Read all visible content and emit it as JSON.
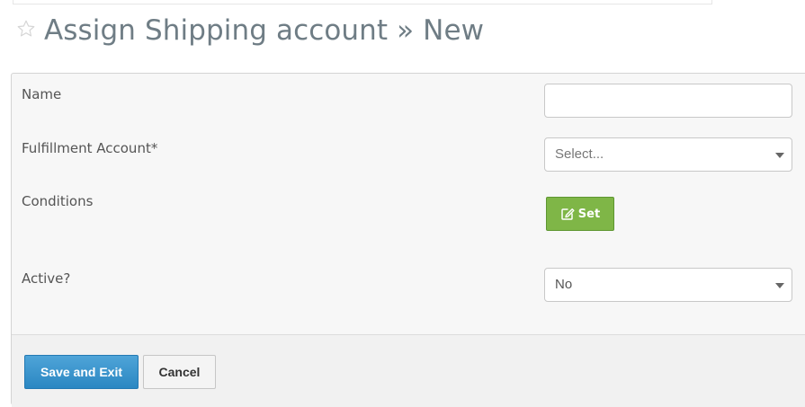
{
  "header": {
    "title": "Assign Shipping account » New",
    "favorite_icon": "star-outline-icon"
  },
  "form": {
    "name_label": "Name",
    "name_value": "",
    "fulfillment_label": "Fulfillment Account*",
    "fulfillment_value": "Select...",
    "conditions_label": "Conditions",
    "set_label": "Set",
    "set_icon": "edit-icon",
    "active_label": "Active?",
    "active_value": "No"
  },
  "footer": {
    "save_label": "Save and Exit",
    "cancel_label": "Cancel"
  },
  "colors": {
    "primary": "#2b87c2",
    "success": "#7fb647",
    "title": "#6f7d85"
  }
}
